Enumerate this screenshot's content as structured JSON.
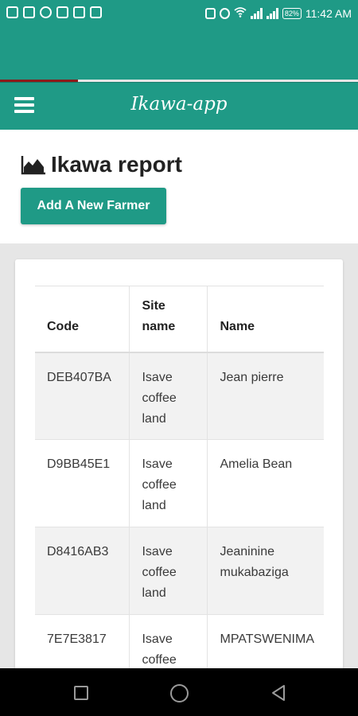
{
  "status_bar": {
    "time": "11:42 AM",
    "battery": "82%",
    "left_icons": [
      "facebook-icon",
      "twitter-icon",
      "skype-icon",
      "image-icon",
      "news-icon",
      "notification-icon"
    ],
    "right_icons": [
      "vibrate-icon",
      "alarm-icon",
      "wifi-icon",
      "signal-icon",
      "signal-icon",
      "battery-icon"
    ]
  },
  "navbar": {
    "brand": "Ikawa-app",
    "menu_icon": "hamburger-icon"
  },
  "page": {
    "title": "Ikawa report",
    "title_icon": "area-chart-icon",
    "add_button": "Add A New Farmer"
  },
  "table": {
    "headers": {
      "code": "Code",
      "site": "Site name",
      "name": "Name"
    },
    "rows": [
      {
        "code": "DEB407BA",
        "site": "Isave coffee land",
        "name": "Jean pierre"
      },
      {
        "code": "D9BB45E1",
        "site": "Isave coffee land",
        "name": "Amelia Bean"
      },
      {
        "code": "D8416AB3",
        "site": "Isave coffee land",
        "name": "Jeaninine mukabaziga"
      },
      {
        "code": "7E7E3817",
        "site": "Isave coffee land",
        "name": "MPATSWENIMA"
      }
    ]
  },
  "colors": {
    "primary": "#1f9a86",
    "progress": "#8b1a1a",
    "stripe": "#f2f2f2"
  }
}
